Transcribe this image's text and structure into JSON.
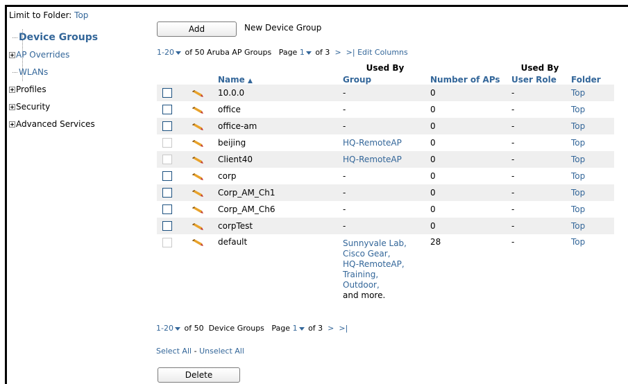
{
  "left_nav": {
    "limit_label": "Limit to Folder:",
    "limit_value": "Top",
    "items": [
      {
        "label": "Device Groups",
        "style": "active",
        "has_expander": false
      },
      {
        "label": "AP Overrides",
        "style": "link",
        "has_expander": true
      },
      {
        "label": "WLANs",
        "style": "link",
        "has_expander": false
      },
      {
        "label": "Profiles",
        "style": "plain",
        "has_expander": true
      },
      {
        "label": "Security",
        "style": "plain",
        "has_expander": true
      },
      {
        "label": "Advanced Services",
        "style": "plain",
        "has_expander": true
      }
    ]
  },
  "toolbar": {
    "add_label": "Add",
    "new_group_label": "New Device Group",
    "delete_label": "Delete"
  },
  "pager_top": {
    "range": "1-20",
    "of_text": "of 50 Aruba AP Groups",
    "page_label": "Page",
    "page": "1",
    "of_pages": "of 3",
    "next": ">",
    "last": ">|",
    "edit_columns": "Edit Columns"
  },
  "pager_bottom": {
    "range": "1-20",
    "of_text": "of 50",
    "label": "Device Groups",
    "page_label": "Page",
    "page": "1",
    "of_pages": "of 3",
    "next": ">",
    "last": ">|"
  },
  "select_links": {
    "select_all": "Select All",
    "separator": "-",
    "unselect_all": "Unselect All"
  },
  "table": {
    "headers": {
      "name": "Name",
      "sort_indicator": "▲",
      "used_by_group_top": "Used By",
      "used_by_group_bottom": "Group",
      "number_of_aps": "Number of APs",
      "used_by_role_top": "Used By",
      "used_by_role_bottom": "User Role",
      "folder": "Folder"
    },
    "rows": [
      {
        "name": "10.0.0",
        "group": "-",
        "group_is_link": false,
        "aps": "0",
        "role": "-",
        "folder": "Top",
        "checkbox_enabled": true
      },
      {
        "name": "office",
        "group": "-",
        "group_is_link": false,
        "aps": "0",
        "role": "-",
        "folder": "Top",
        "checkbox_enabled": true
      },
      {
        "name": "office-am",
        "group": "-",
        "group_is_link": false,
        "aps": "0",
        "role": "-",
        "folder": "Top",
        "checkbox_enabled": true
      },
      {
        "name": "beijing",
        "group": "HQ-RemoteAP",
        "group_is_link": true,
        "aps": "0",
        "role": "-",
        "folder": "Top",
        "checkbox_enabled": false
      },
      {
        "name": "Client40",
        "group": "HQ-RemoteAP",
        "group_is_link": true,
        "aps": "0",
        "role": "-",
        "folder": "Top",
        "checkbox_enabled": false
      },
      {
        "name": "corp",
        "group": "-",
        "group_is_link": false,
        "aps": "0",
        "role": "-",
        "folder": "Top",
        "checkbox_enabled": true
      },
      {
        "name": "Corp_AM_Ch1",
        "group": "-",
        "group_is_link": false,
        "aps": "0",
        "role": "-",
        "folder": "Top",
        "checkbox_enabled": true
      },
      {
        "name": "Corp_AM_Ch6",
        "group": "-",
        "group_is_link": false,
        "aps": "0",
        "role": "-",
        "folder": "Top",
        "checkbox_enabled": true
      },
      {
        "name": "corpTest",
        "group": "-",
        "group_is_link": false,
        "aps": "0",
        "role": "-",
        "folder": "Top",
        "checkbox_enabled": true
      }
    ],
    "last_row": {
      "name": "default",
      "groups": [
        "Sunnyvale Lab,",
        "Cisco Gear,",
        "HQ-RemoteAP,",
        "Training,",
        "Outdoor,"
      ],
      "more_text": "and more.",
      "aps": "28",
      "role": "-",
      "folder": "Top",
      "checkbox_enabled": false
    }
  },
  "colors": {
    "link": "#336699",
    "row_alt": "#efefef",
    "pencil_body": "#e8a22a",
    "pencil_tip": "#c0392b"
  },
  "icons": {
    "edit": "pencil-icon",
    "expander": "plus-box-icon",
    "dropdown": "caret-down-icon"
  }
}
